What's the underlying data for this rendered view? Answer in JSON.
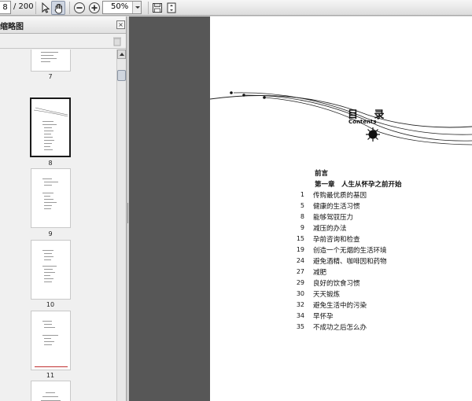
{
  "toolbar": {
    "page_current": "8",
    "page_total_label": "/ 200",
    "zoom": "50%"
  },
  "panel": {
    "title": "缩略图",
    "close_glyph": "×"
  },
  "thumbnails": [
    {
      "label": "7"
    },
    {
      "label": "8",
      "selected": true
    },
    {
      "label": "9"
    },
    {
      "label": "10"
    },
    {
      "label": "11"
    }
  ],
  "document": {
    "title": "目 录",
    "subtitle": "Contents",
    "preface": "前言",
    "chapter1": "第一章　人生从怀孕之前开始",
    "entries": [
      {
        "page": "1",
        "text": "传购最优质的基因"
      },
      {
        "page": "5",
        "text": "健康的生活习惯"
      },
      {
        "page": "8",
        "text": "能够驾驭压力"
      },
      {
        "page": "9",
        "text": "减压的办法"
      },
      {
        "page": "15",
        "text": "孕前咨询和检查"
      },
      {
        "page": "19",
        "text": "创造一个无烟的生活环境"
      },
      {
        "page": "24",
        "text": "避免酒精、咖啡因和药物"
      },
      {
        "page": "27",
        "text": "减肥"
      },
      {
        "page": "29",
        "text": "良好的饮食习惯"
      },
      {
        "page": "30",
        "text": "天天锻炼"
      },
      {
        "page": "32",
        "text": "避免生活中的污染"
      },
      {
        "page": "34",
        "text": "早怀孕"
      },
      {
        "page": "35",
        "text": "不成功之后怎么办"
      }
    ]
  },
  "colors": {
    "doc_background": "#575757",
    "panel_background": "#efefef",
    "thumb_red_line": "#c03030"
  },
  "icons": [
    "select-arrow-icon",
    "hand-tool-icon",
    "zoom-out-icon",
    "zoom-in-icon",
    "save-icon",
    "fit-page-icon",
    "trash-icon",
    "close-icon"
  ]
}
